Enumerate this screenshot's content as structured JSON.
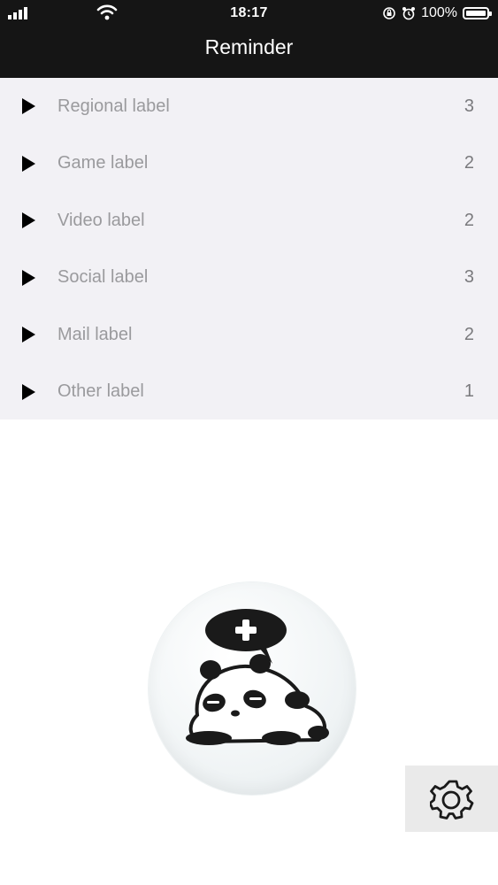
{
  "status_bar": {
    "time": "18:17",
    "battery": "100%"
  },
  "header": {
    "title": "Reminder"
  },
  "labels": [
    {
      "name": "Regional label",
      "count": "3"
    },
    {
      "name": "Game label",
      "count": "2"
    },
    {
      "name": "Video label",
      "count": "2"
    },
    {
      "name": "Social label",
      "count": "3"
    },
    {
      "name": "Mail label",
      "count": "2"
    },
    {
      "name": "Other label",
      "count": "1"
    }
  ],
  "icons": {
    "add_button": "panda-add-icon",
    "settings_button": "gear-icon"
  }
}
